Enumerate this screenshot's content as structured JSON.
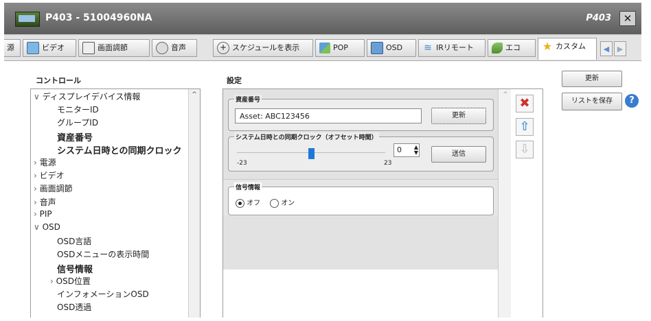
{
  "window": {
    "title": "P403 - 51004960NA",
    "model": "P403",
    "close": "✕"
  },
  "tabs": [
    {
      "label": "源",
      "icon": ""
    },
    {
      "label": "ビデオ",
      "icon": "monitor-icon"
    },
    {
      "label": "画面調節",
      "icon": "screen-adjust-icon"
    },
    {
      "label": "音声",
      "icon": "speaker-icon"
    },
    {
      "label": "スケジュールを表示",
      "icon": "schedule-icon"
    },
    {
      "label": "POP",
      "icon": "pop-icon"
    },
    {
      "label": "OSD",
      "icon": "osd-icon"
    },
    {
      "label": "IRリモート",
      "icon": "wifi-icon"
    },
    {
      "label": "エコ",
      "icon": "eco-icon"
    },
    {
      "label": "カスタム",
      "icon": "star-icon",
      "active": true
    }
  ],
  "tab_arrows": {
    "left": "◀",
    "right": "▶"
  },
  "control": {
    "label": "コントロール",
    "tree": [
      {
        "text": "ディスプレイデバイス情報",
        "prefix": "v",
        "bold": false,
        "level": 0
      },
      {
        "text": "モニターID",
        "prefix": "",
        "bold": false,
        "level": 1
      },
      {
        "text": "グループID",
        "prefix": "",
        "bold": false,
        "level": 1
      },
      {
        "text": "資産番号",
        "prefix": "",
        "bold": true,
        "level": 1
      },
      {
        "text": "システム日時との同期クロック",
        "prefix": "",
        "bold": true,
        "level": 1
      },
      {
        "text": "電源",
        "prefix": ">",
        "bold": false,
        "level": 0
      },
      {
        "text": "ビデオ",
        "prefix": ">",
        "bold": false,
        "level": 0
      },
      {
        "text": "画面調節",
        "prefix": ">",
        "bold": false,
        "level": 0
      },
      {
        "text": "音声",
        "prefix": ">",
        "bold": false,
        "level": 0
      },
      {
        "text": "PIP",
        "prefix": ">",
        "bold": false,
        "level": 0
      },
      {
        "text": "OSD",
        "prefix": "v",
        "bold": false,
        "level": 0
      },
      {
        "text": "OSD言語",
        "prefix": "",
        "bold": false,
        "level": 1
      },
      {
        "text": "OSDメニューの表示時間",
        "prefix": "",
        "bold": false,
        "level": 1
      },
      {
        "text": "信号情報",
        "prefix": "",
        "bold": true,
        "level": 1
      },
      {
        "text": "OSD位置",
        "prefix": ">",
        "bold": false,
        "level": 1
      },
      {
        "text": "インフォメーションOSD",
        "prefix": "",
        "bold": false,
        "level": 1
      },
      {
        "text": "OSD透過",
        "prefix": "",
        "bold": false,
        "level": 1
      }
    ]
  },
  "settings": {
    "label": "設定",
    "asset": {
      "label": "資産番号",
      "value": "Asset: ABC123456",
      "button": "更新"
    },
    "clock": {
      "label": "システム日時との同期クロック（オフセット時間）",
      "min": "-23",
      "max": "23",
      "value": "0",
      "button": "送信",
      "slider_fraction": 0.5
    },
    "signal": {
      "label": "信号情報",
      "off": "オフ",
      "on": "オン",
      "selected": "off"
    }
  },
  "actions": {
    "update": "更新",
    "save_list": "リストを保存",
    "help": "?"
  },
  "colors": {
    "delete": "#d0302a",
    "arrow_up": "#4a9ad8",
    "arrow_down": "#c8c8c8",
    "help": "#3a7ccf"
  }
}
